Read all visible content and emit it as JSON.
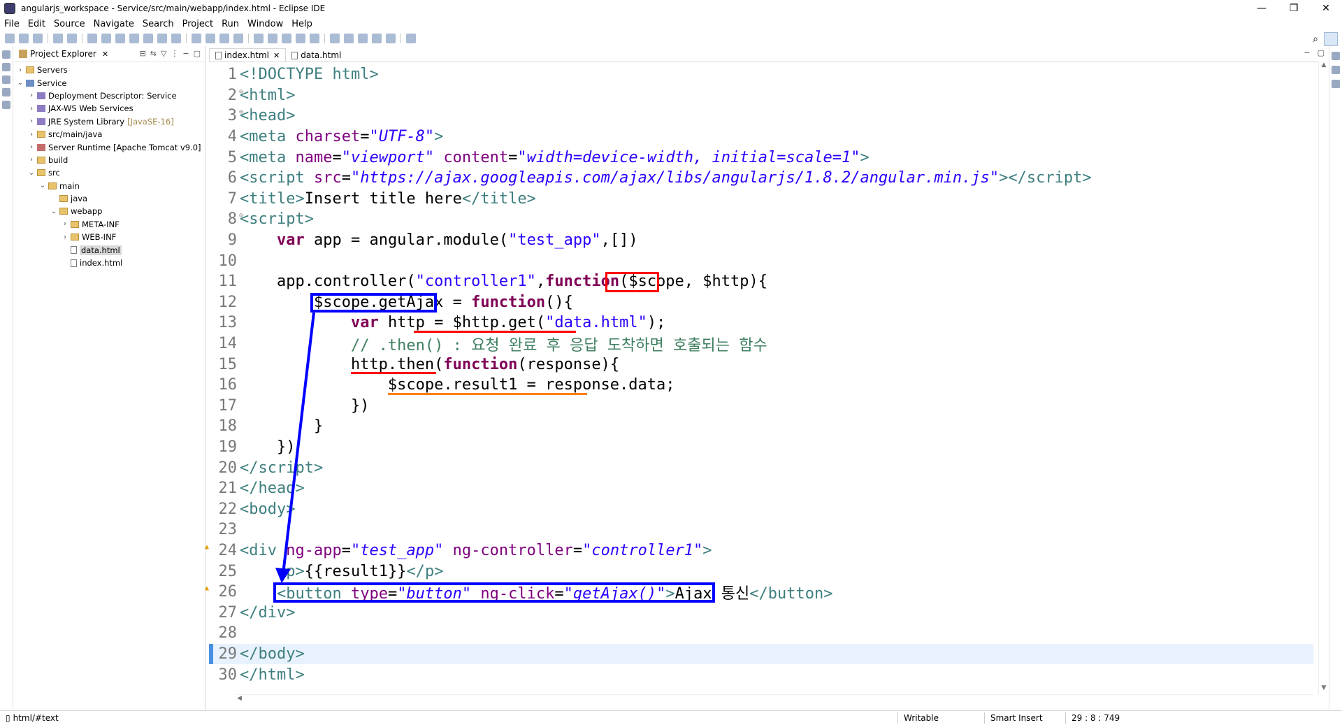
{
  "window": {
    "title": "angularjs_workspace - Service/src/main/webapp/index.html - Eclipse IDE",
    "minimize": "—",
    "restore": "❐",
    "close": "✕"
  },
  "menu": [
    "File",
    "Edit",
    "Source",
    "Navigate",
    "Search",
    "Project",
    "Run",
    "Window",
    "Help"
  ],
  "explorer": {
    "title": "Project Explorer",
    "close": "✕",
    "tree": [
      {
        "label": "Servers",
        "twisty": ">",
        "icon": "folder"
      },
      {
        "label": "Service",
        "twisty": "v",
        "icon": "proj"
      },
      {
        "label": "Deployment Descriptor: Service",
        "twisty": ">",
        "icon": "lib"
      },
      {
        "label": "JAX-WS Web Services",
        "twisty": ">",
        "icon": "lib"
      },
      {
        "label": "JRE System Library",
        "suffix": "[JavaSE-16]",
        "twisty": ">",
        "icon": "lib"
      },
      {
        "label": "src/main/java",
        "twisty": ">",
        "icon": "folder"
      },
      {
        "label": "Server Runtime [Apache Tomcat v9.0]",
        "twisty": ">",
        "icon": "srv"
      },
      {
        "label": "build",
        "twisty": ">",
        "icon": "folder"
      },
      {
        "label": "src",
        "twisty": "v",
        "icon": "folder"
      },
      {
        "label": "main",
        "twisty": "v",
        "icon": "folder"
      },
      {
        "label": "java",
        "twisty": "",
        "icon": "folder"
      },
      {
        "label": "webapp",
        "twisty": "v",
        "icon": "folder"
      },
      {
        "label": "META-INF",
        "twisty": ">",
        "icon": "folder"
      },
      {
        "label": "WEB-INF",
        "twisty": ">",
        "icon": "folder"
      },
      {
        "label": "data.html",
        "twisty": "",
        "icon": "file",
        "selected": true
      },
      {
        "label": "index.html",
        "twisty": "",
        "icon": "file"
      }
    ]
  },
  "editor": {
    "tabs": [
      {
        "label": "index.html",
        "active": true,
        "close": "✕"
      },
      {
        "label": "data.html",
        "active": false
      }
    ],
    "lines": [
      [
        [
          "tg",
          "<!DOCTYPE "
        ],
        [
          "tn",
          "html"
        ],
        [
          "tg",
          ">"
        ]
      ],
      [
        [
          "tg",
          "<"
        ],
        [
          "tn",
          "html"
        ],
        [
          "tg",
          ">"
        ]
      ],
      [
        [
          "tg",
          "<"
        ],
        [
          "tn",
          "head"
        ],
        [
          "tg",
          ">"
        ]
      ],
      [
        [
          "tg",
          "<"
        ],
        [
          "tn",
          "meta "
        ],
        [
          "at",
          "charset"
        ],
        [
          "pl",
          "="
        ],
        [
          "av",
          "\"UTF-8\""
        ],
        [
          "tg",
          ">"
        ]
      ],
      [
        [
          "tg",
          "<"
        ],
        [
          "tn",
          "meta "
        ],
        [
          "at",
          "name"
        ],
        [
          "pl",
          "="
        ],
        [
          "av",
          "\"viewport\""
        ],
        [
          "pl",
          " "
        ],
        [
          "at",
          "content"
        ],
        [
          "pl",
          "="
        ],
        [
          "av",
          "\"width=device-width, initial=scale=1\""
        ],
        [
          "tg",
          ">"
        ]
      ],
      [
        [
          "tg",
          "<"
        ],
        [
          "tn",
          "script "
        ],
        [
          "at",
          "src"
        ],
        [
          "pl",
          "="
        ],
        [
          "av",
          "\"https://ajax.googleapis.com/ajax/libs/angularjs/1.8.2/angular.min.js\""
        ],
        [
          "tg",
          "></"
        ],
        [
          "tn",
          "script"
        ],
        [
          "tg",
          ">"
        ]
      ],
      [
        [
          "tg",
          "<"
        ],
        [
          "tn",
          "title"
        ],
        [
          "tg",
          ">"
        ],
        [
          "pl",
          "Insert title here"
        ],
        [
          "tg",
          "</"
        ],
        [
          "tn",
          "title"
        ],
        [
          "tg",
          ">"
        ]
      ],
      [
        [
          "tg",
          "<"
        ],
        [
          "tn",
          "script"
        ],
        [
          "tg",
          ">"
        ]
      ],
      [
        [
          "pl",
          "    "
        ],
        [
          "kw",
          "var"
        ],
        [
          "pl",
          " app = angular.module("
        ],
        [
          "st",
          "\"test_app\""
        ],
        [
          "pl",
          ",[])"
        ]
      ],
      [],
      [
        [
          "pl",
          "    app.controller("
        ],
        [
          "st",
          "\"controller1\""
        ],
        [
          "pl",
          ","
        ],
        [
          "kw",
          "function"
        ],
        [
          "pl",
          "($scope, $http){"
        ]
      ],
      [
        [
          "pl",
          "        $scope.getAjax = "
        ],
        [
          "kw",
          "function"
        ],
        [
          "pl",
          "(){"
        ]
      ],
      [
        [
          "pl",
          "            "
        ],
        [
          "kw",
          "var"
        ],
        [
          "pl",
          " http = $http.get("
        ],
        [
          "st",
          "\"data.html\""
        ],
        [
          "pl",
          ");"
        ]
      ],
      [
        [
          "pl",
          "            "
        ],
        [
          "cm",
          "// .then() : 요청 완료 후 응답 도착하면 호출되는 함수"
        ]
      ],
      [
        [
          "pl",
          "            http.then("
        ],
        [
          "kw",
          "function"
        ],
        [
          "pl",
          "(response){"
        ]
      ],
      [
        [
          "pl",
          "                $scope.result1 = response.data;"
        ]
      ],
      [
        [
          "pl",
          "            })"
        ]
      ],
      [
        [
          "pl",
          "        }"
        ]
      ],
      [
        [
          "pl",
          "    })"
        ]
      ],
      [
        [
          "tg",
          "</"
        ],
        [
          "tn",
          "script"
        ],
        [
          "tg",
          ">"
        ]
      ],
      [
        [
          "tg",
          "</"
        ],
        [
          "tn",
          "head"
        ],
        [
          "tg",
          ">"
        ]
      ],
      [
        [
          "tg",
          "<"
        ],
        [
          "tn",
          "body"
        ],
        [
          "tg",
          ">"
        ]
      ],
      [],
      [
        [
          "tg",
          "<"
        ],
        [
          "tn",
          "div "
        ],
        [
          "at",
          "ng-app"
        ],
        [
          "pl",
          "="
        ],
        [
          "av",
          "\"test_app\""
        ],
        [
          "pl",
          " "
        ],
        [
          "at",
          "ng-controller"
        ],
        [
          "pl",
          "="
        ],
        [
          "av",
          "\"controller1\""
        ],
        [
          "tg",
          ">"
        ]
      ],
      [
        [
          "pl",
          "    "
        ],
        [
          "tg",
          "<"
        ],
        [
          "tn",
          "p"
        ],
        [
          "tg",
          ">"
        ],
        [
          "pl",
          "{{result1}}"
        ],
        [
          "tg",
          "</"
        ],
        [
          "tn",
          "p"
        ],
        [
          "tg",
          ">"
        ]
      ],
      [
        [
          "pl",
          "    "
        ],
        [
          "tg",
          "<"
        ],
        [
          "tn",
          "button "
        ],
        [
          "at",
          "type"
        ],
        [
          "pl",
          "="
        ],
        [
          "av",
          "\"button\""
        ],
        [
          "pl",
          " "
        ],
        [
          "at",
          "ng-click"
        ],
        [
          "pl",
          "="
        ],
        [
          "av",
          "\"getAjax()\""
        ],
        [
          "tg",
          ">"
        ],
        [
          "pl",
          "Ajax 통신"
        ],
        [
          "tg",
          "</"
        ],
        [
          "tn",
          "button"
        ],
        [
          "tg",
          ">"
        ]
      ],
      [
        [
          "tg",
          "</"
        ],
        [
          "tn",
          "div"
        ],
        [
          "tg",
          ">"
        ]
      ],
      [],
      [
        [
          "tg",
          "</"
        ],
        [
          "tn",
          "body"
        ],
        [
          "tg",
          ">"
        ]
      ],
      [
        [
          "tg",
          "</"
        ],
        [
          "tn",
          "html"
        ],
        [
          "tg",
          ">"
        ]
      ]
    ],
    "fold_lines": [
      2,
      3,
      8
    ],
    "warn_lines": [
      24,
      26
    ],
    "current_line": 29
  },
  "status": {
    "path": "html/#text",
    "mode": "Writable",
    "insert": "Smart Insert",
    "position": "29 : 8 : 749"
  },
  "colors": {
    "annotation_red": "#ff0000",
    "annotation_blue": "#0000ff",
    "annotation_orange": "#ff7f00"
  }
}
